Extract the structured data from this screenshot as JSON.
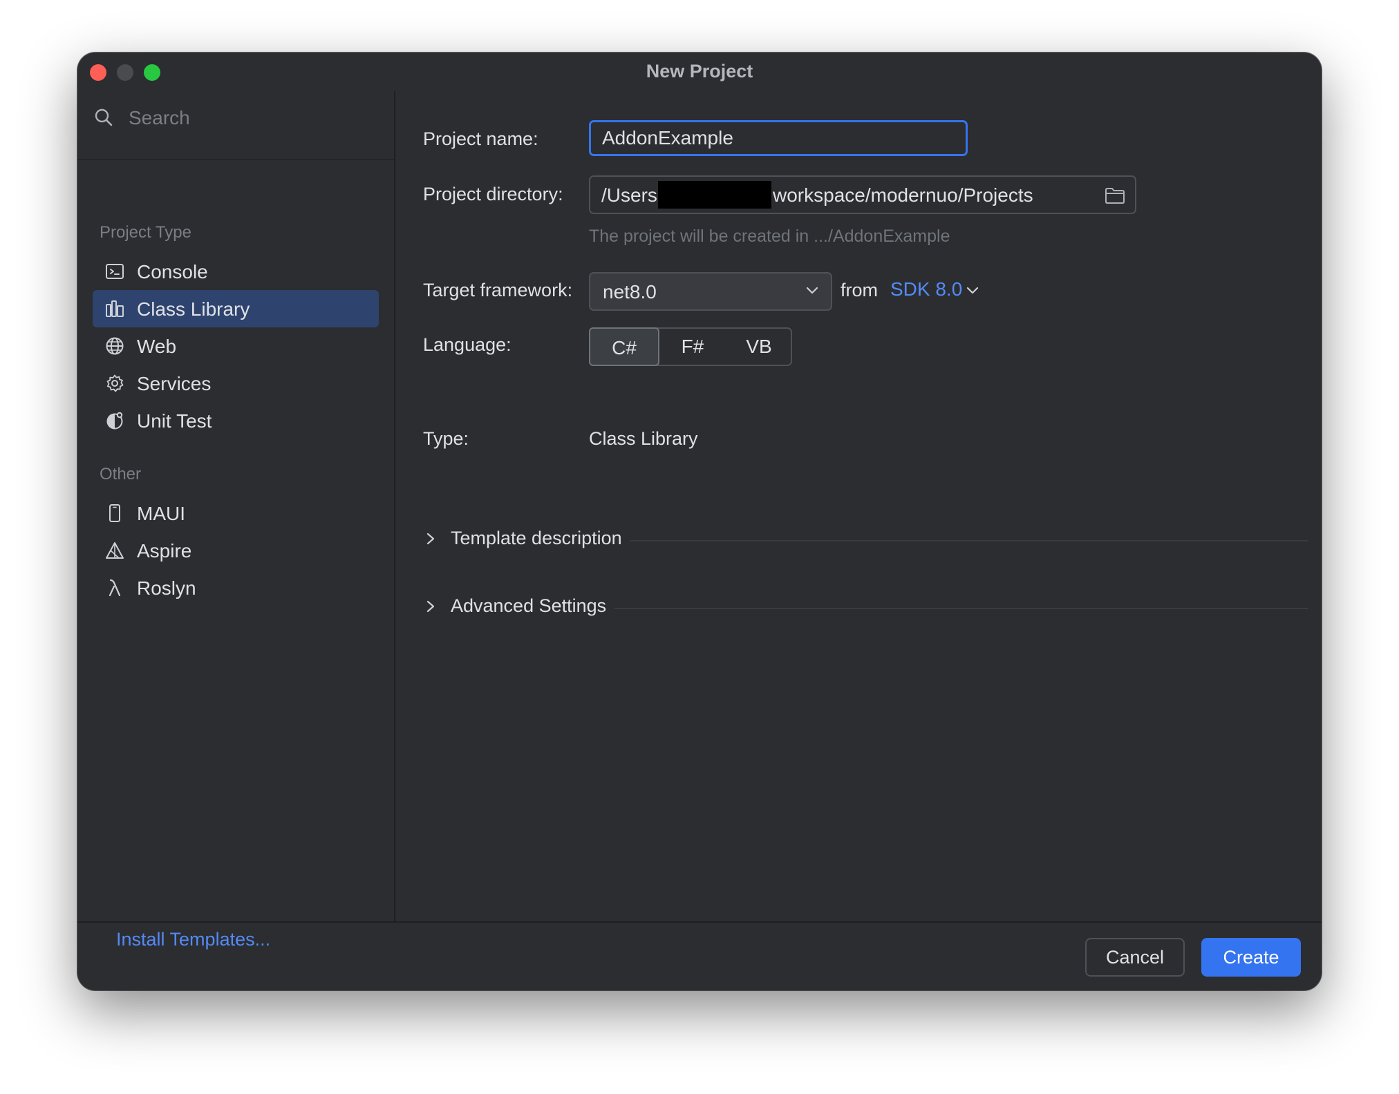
{
  "window": {
    "title": "New Project"
  },
  "search": {
    "placeholder": "Search"
  },
  "sidebar": {
    "sections": [
      {
        "title": "Project Type",
        "items": [
          {
            "label": "Console",
            "icon": "console-icon"
          },
          {
            "label": "Class Library",
            "icon": "class-library-icon",
            "selected": true
          },
          {
            "label": "Web",
            "icon": "globe-icon"
          },
          {
            "label": "Services",
            "icon": "gear-icon"
          },
          {
            "label": "Unit Test",
            "icon": "unit-test-icon"
          }
        ]
      },
      {
        "title": "Other",
        "items": [
          {
            "label": "MAUI",
            "icon": "phone-icon"
          },
          {
            "label": "Aspire",
            "icon": "aspire-icon"
          },
          {
            "label": "Roslyn",
            "icon": "lambda-icon"
          }
        ]
      }
    ],
    "install_templates": "Install Templates..."
  },
  "form": {
    "project_name_label": "Project name:",
    "project_name_value": "AddonExample",
    "project_directory_label": "Project directory:",
    "project_directory_prefix": "/Users",
    "project_directory_suffix": "workspace/modernuo/Projects",
    "directory_hint": "The project will be created in .../AddonExample",
    "target_framework_label": "Target framework:",
    "target_framework_value": "net8.0",
    "from_label": "from",
    "sdk_value": "SDK 8.0",
    "language_label": "Language:",
    "languages": [
      "C#",
      "F#",
      "VB"
    ],
    "selected_language": "C#",
    "type_label": "Type:",
    "type_value": "Class Library",
    "template_description": "Template description",
    "advanced_settings": "Advanced Settings"
  },
  "footer": {
    "cancel_label": "Cancel",
    "create_label": "Create"
  },
  "colors": {
    "accent": "#3574f0",
    "link": "#548af7",
    "background": "#2b2d30",
    "selected": "#2e436e"
  }
}
